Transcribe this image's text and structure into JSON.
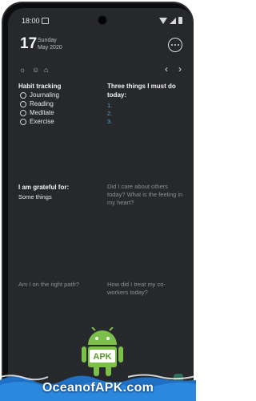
{
  "status_bar": {
    "time": "18:00"
  },
  "header": {
    "day_number": "17",
    "day_name": "Sunday",
    "month_year": "May 2020"
  },
  "toolbar": {
    "icons": [
      "sun-icon",
      "mood-icon",
      "tag-icon"
    ],
    "prev": "‹",
    "next": "›"
  },
  "habit_tracking": {
    "title": "Habit tracking",
    "items": [
      "Journaling",
      "Reading",
      "Meditate",
      "Exercise"
    ]
  },
  "three_things": {
    "title": "Three things I must do today:",
    "items": [
      "1.",
      "2.",
      "3."
    ]
  },
  "grateful": {
    "title": "I am grateful for:",
    "text": "Some things"
  },
  "prompts": {
    "care": "Did I care about others today? What is the feeling in my heart?",
    "path": "Am I on the right path?",
    "treat": "How did I treat my co-workers today?"
  },
  "watermark": {
    "text": "OceanofAPK.com",
    "badge": "APK"
  }
}
